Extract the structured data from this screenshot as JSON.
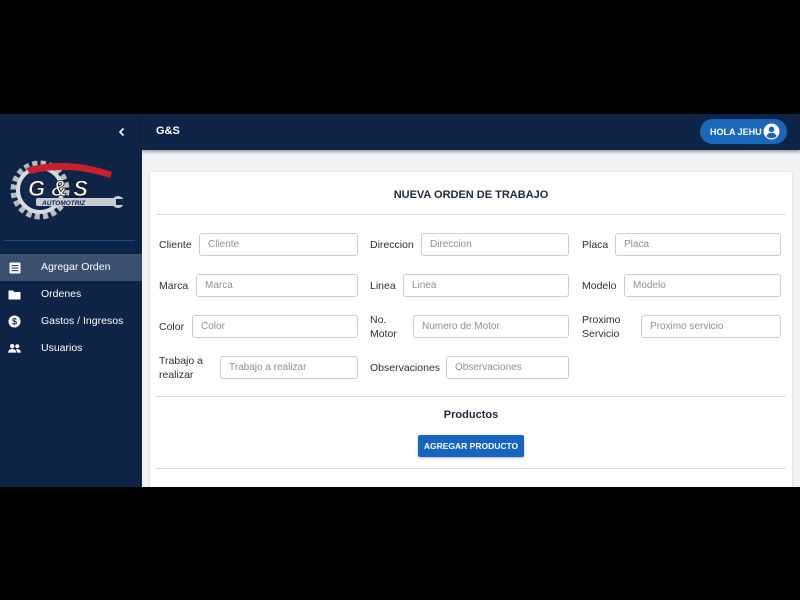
{
  "app": {
    "title": "G&S"
  },
  "user": {
    "greeting": "HOLA JEHU",
    "icon": "account-circle-icon"
  },
  "sidebar": {
    "collapse_icon": "chevron-left-icon",
    "logo_text": "G & S",
    "logo_subtext": "AUTOMOTRIZ",
    "items": [
      {
        "label": "Agregar Orden",
        "icon": "list-icon",
        "active": true
      },
      {
        "label": "Ordenes",
        "icon": "folder-icon",
        "active": false
      },
      {
        "label": "Gastos / Ingresos",
        "icon": "dollar-icon",
        "active": false
      },
      {
        "label": "Usuarios",
        "icon": "people-icon",
        "active": false
      }
    ]
  },
  "form": {
    "title": "NUEVA ORDEN DE TRABAJO",
    "fields": {
      "cliente": {
        "label": "Cliente",
        "placeholder": "Cliente",
        "value": ""
      },
      "direccion": {
        "label": "Direccion",
        "placeholder": "Direccion",
        "value": ""
      },
      "placa": {
        "label": "Placa",
        "placeholder": "Placa",
        "value": ""
      },
      "marca": {
        "label": "Marca",
        "placeholder": "Marca",
        "value": ""
      },
      "linea": {
        "label": "Linea",
        "placeholder": "Linea",
        "value": ""
      },
      "modelo": {
        "label": "Modelo",
        "placeholder": "Modelo",
        "value": ""
      },
      "color": {
        "label": "Color",
        "placeholder": "Color",
        "value": ""
      },
      "no_motor": {
        "label_line1": "No.",
        "label_line2": "Motor",
        "placeholder": "Numero de Motor",
        "value": ""
      },
      "proximo_servicio": {
        "label_line1": "Proximo",
        "label_line2": "Servicio",
        "placeholder": "Proximo servicio",
        "value": ""
      },
      "trabajo": {
        "label_line1": "Trabajo a",
        "label_line2": "realizar",
        "placeholder": "Trabajo a realizar",
        "value": ""
      },
      "observaciones": {
        "label": "Observaciones",
        "placeholder": "Observaciones",
        "value": ""
      }
    }
  },
  "productos": {
    "title": "Productos",
    "add_button": "AGREGAR PRODUCTO"
  },
  "colors": {
    "navy": "#0d2447",
    "accent": "#1565c0",
    "active_nav": "#3b4f6e"
  }
}
